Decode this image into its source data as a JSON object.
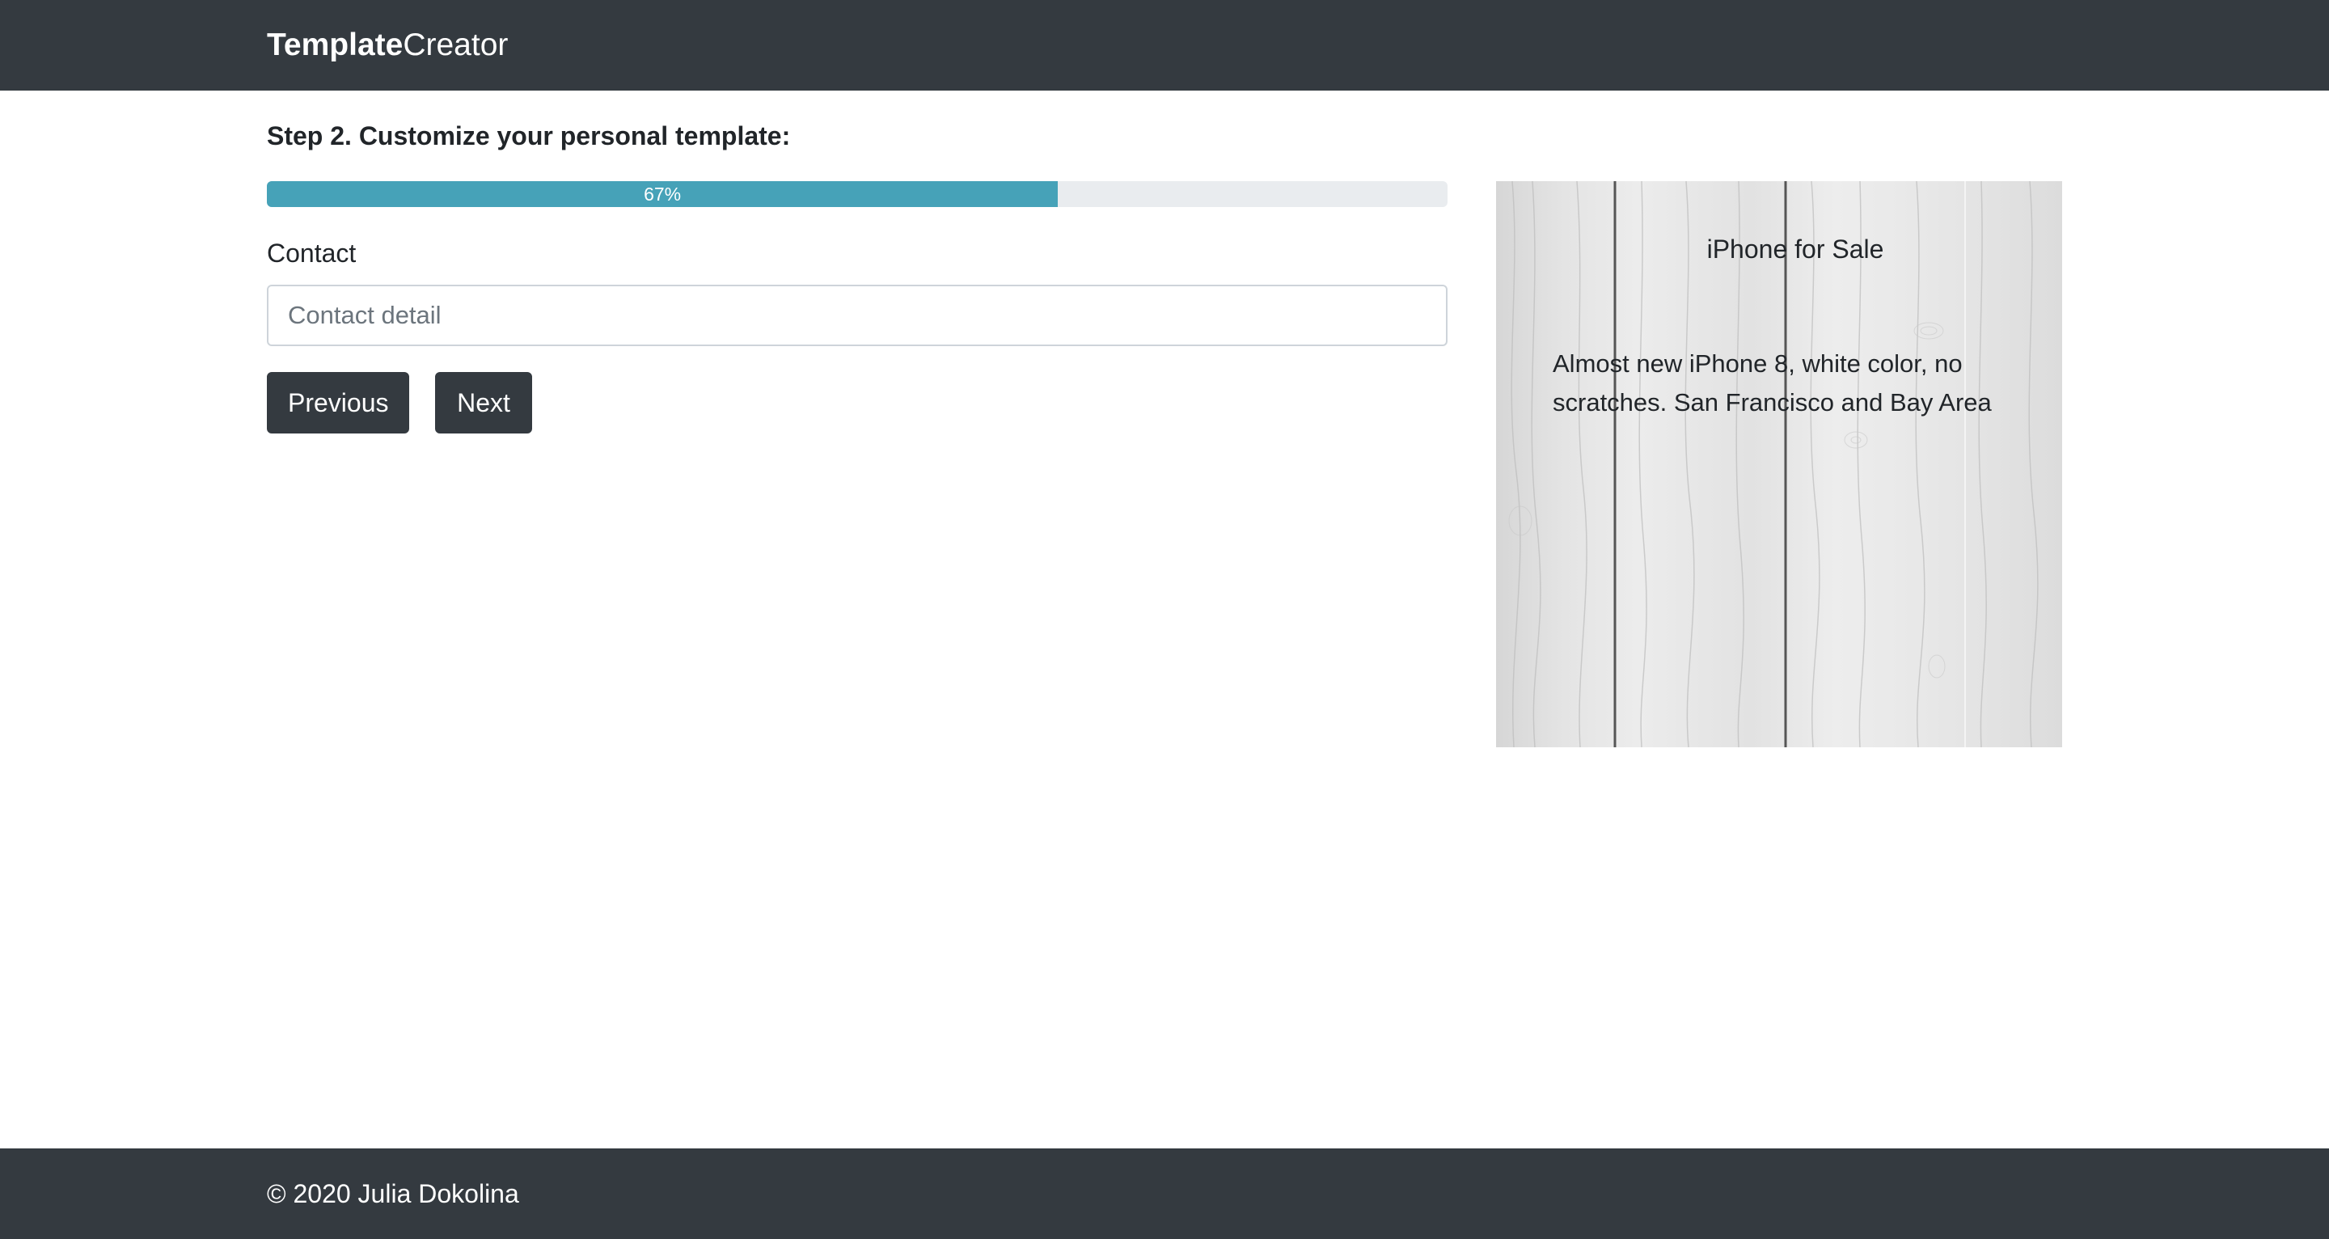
{
  "navbar": {
    "brand_bold": "Template",
    "brand_light": "Creator"
  },
  "step": {
    "label": "Step 2.",
    "text": " Customize your personal template:"
  },
  "progress": {
    "percent": 67,
    "label": "67%",
    "fill_color": "#46a2b8"
  },
  "form": {
    "contact_label": "Contact",
    "contact_placeholder": "Contact detail",
    "contact_value": ""
  },
  "buttons": {
    "previous_label": "Previous",
    "next_label": "Next"
  },
  "preview": {
    "title": "iPhone for Sale",
    "body": "Almost new iPhone 8, white color, no scratches. San Francisco and Bay Area"
  },
  "footer": {
    "copyright": "© 2020 Julia Dokolina"
  },
  "colors": {
    "navbar_bg": "#343a40",
    "progress_fill": "#46a2b8",
    "button_bg": "#343a40"
  }
}
